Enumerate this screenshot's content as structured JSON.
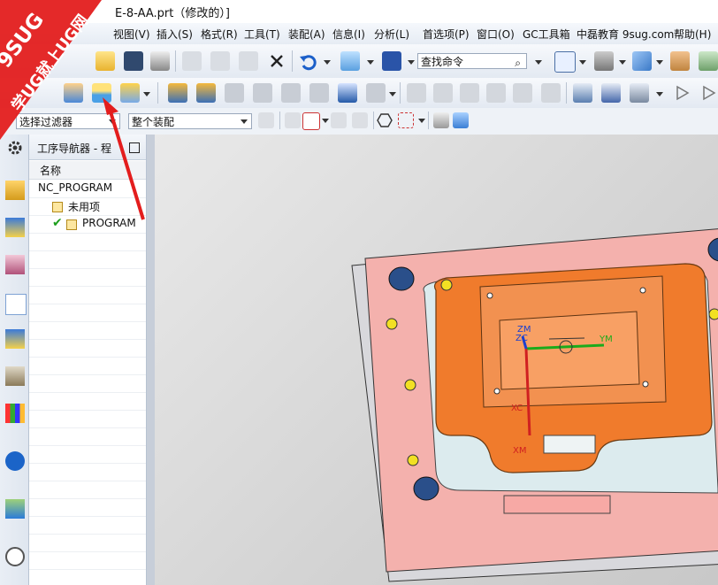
{
  "window": {
    "title": "E-8-AA.prt（修改的）]"
  },
  "menu": {
    "items": [
      "视图(V)",
      "插入(S)",
      "格式(R)",
      "工具(T)",
      "装配(A)",
      "信息(I)",
      "分析(L)",
      "首选项(P)",
      "窗口(O)",
      "GC工具箱",
      "中磊教育 9sug.com",
      "帮助(H)"
    ]
  },
  "toolbar": {
    "search_placeholder": "查找命令"
  },
  "filters": {
    "selection_filter": "选择过滤器",
    "assembly_scope": "整个装配"
  },
  "navigator": {
    "title": "工序导航器 - 程",
    "column_name": "名称",
    "root": "NC_PROGRAM",
    "items": [
      {
        "label": "未用项"
      },
      {
        "label": "PROGRAM"
      }
    ]
  },
  "viewport": {
    "axes": {
      "zm": "ZM",
      "zc": "ZC",
      "ym": "YM",
      "xc": "XC",
      "xm": "XM"
    }
  },
  "overlay": {
    "brand_top": "9SUG",
    "brand_bottom": "学UG就上UG网"
  },
  "colors": {
    "plate": "#f4b1ad",
    "core": "#f07b2c",
    "axis_y": "#1bab1b",
    "axis_x": "#d02020",
    "axis_z": "#1a3fd0",
    "banner": "#e31d1d"
  }
}
